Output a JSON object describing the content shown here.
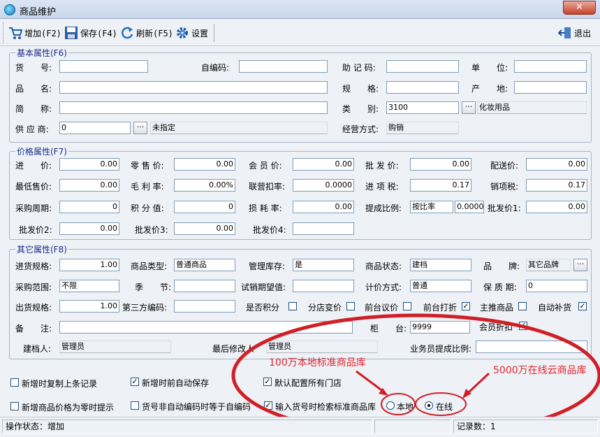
{
  "window": {
    "title": "商品维护",
    "close_glyph": "✕"
  },
  "toolbar": {
    "add": "增加(F2)",
    "save": "保存(F4)",
    "refresh": "刷新(F5)",
    "settings": "设置",
    "exit": "退出"
  },
  "basic": {
    "title": "基本属性(F6)",
    "item_no_label": "货　　号:",
    "item_no": "",
    "self_code_label": "自编码:",
    "self_code": "",
    "mnemonic_label": "助 记 码:",
    "mnemonic": "",
    "unit_label": "单　　位:",
    "unit": "",
    "name_label": "品　　名:",
    "name": "",
    "spec_label": "规　　格:",
    "spec": "",
    "origin_label": "产　　地:",
    "origin": "",
    "short_label": "简　　称:",
    "short": "",
    "category_label": "类　　别:",
    "category_code": "3100",
    "category_name": "化妆用品",
    "supplier_label": "供 应 商:",
    "supplier_code": "0",
    "supplier_name": "未指定",
    "biz_label": "经营方式:",
    "biz_mode": "购销"
  },
  "price": {
    "title": "价格属性(F7)",
    "cost_label": "进　　价:",
    "cost": "0.00",
    "retail_label": "零 售 价:",
    "retail": "0.00",
    "member_label": "会 员 价:",
    "member": "0.00",
    "wholesale_label": "批 发 价:",
    "wholesale": "0.00",
    "delivery_label": "配送价:",
    "delivery": "0.00",
    "min_label": "最低售价:",
    "min": "0.00",
    "margin_label": "毛 利 率:",
    "margin": "0.00%",
    "deduct_label": "联营扣率:",
    "deduct": "0.0000",
    "input_tax_label": "进 项 税:",
    "input_tax": "0.17",
    "output_tax_label": "销项税:",
    "output_tax": "0.17",
    "cycle_label": "采购周期:",
    "cycle": "0",
    "points_label": "积 分 值:",
    "points": "0",
    "loss_label": "损 耗 率:",
    "loss": "0.00",
    "commission_label": "提成比例:",
    "commission_mode": "按比率",
    "commission": "0.0000",
    "w1_label": "批发价1:",
    "w1": "0.00",
    "w2_label": "批发价2:",
    "w2": "0.00",
    "w3_label": "批发价3:",
    "w3": "0.00",
    "w4_label": "批发价4:",
    "w4": ""
  },
  "other": {
    "title": "其它属性(F8)",
    "in_spec_label": "进货规格:",
    "in_spec": "1.00",
    "type_label": "商品类型:",
    "type": "普通商品",
    "stock_label": "管理库存:",
    "stock": "是",
    "status_label": "商品状态:",
    "status": "建档",
    "brand_label": "品　　牌:",
    "brand": "其它品牌",
    "range_label": "采购范围:",
    "range": "不限",
    "season_label": "季　　节:",
    "season": "",
    "trial_label": "试销期望值:",
    "trial": "",
    "pricing_label": "计价方式:",
    "pricing": "普通",
    "shelf_label": "保 质 期:",
    "shelf": "0",
    "out_spec_label": "出货规格:",
    "out_spec": "1.00",
    "third_label": "第三方编码:",
    "third": "",
    "points_cb": "是否积分",
    "branch_cb": "分店变价",
    "front_price_cb": "前台议价",
    "front_disc_cb": "前台打折",
    "promo_cb": "主推商品",
    "auto_cb": "自动补货",
    "note_label": "备　　注:",
    "note": "",
    "counter_label": "柜　　台:",
    "counter": "9999",
    "member_disc_label": "会员折扣",
    "creator_label": "建档人:",
    "creator": "管理员",
    "modifier_label": "最后修改人",
    "modifier": "管理员",
    "sales_ratio_label": "业务员提成比例:",
    "sales_ratio": ""
  },
  "options": {
    "copy_prev": "新增时复制上条记录",
    "auto_save": "新增时前自动保存",
    "default_shops": "默认配置所有门店",
    "zero_price": "新增商品价格为零时提示",
    "code_eq": "货号非自动编码时等于自编码",
    "search_std": "输入货号时检索标准商品库",
    "local": "本地",
    "online": "在线"
  },
  "annotations": {
    "local_db": "100万本地标准商品库",
    "cloud_db": "5000万在线云商品库"
  },
  "status": {
    "op_state": "操作状态：增加",
    "records": "记录数：1"
  }
}
